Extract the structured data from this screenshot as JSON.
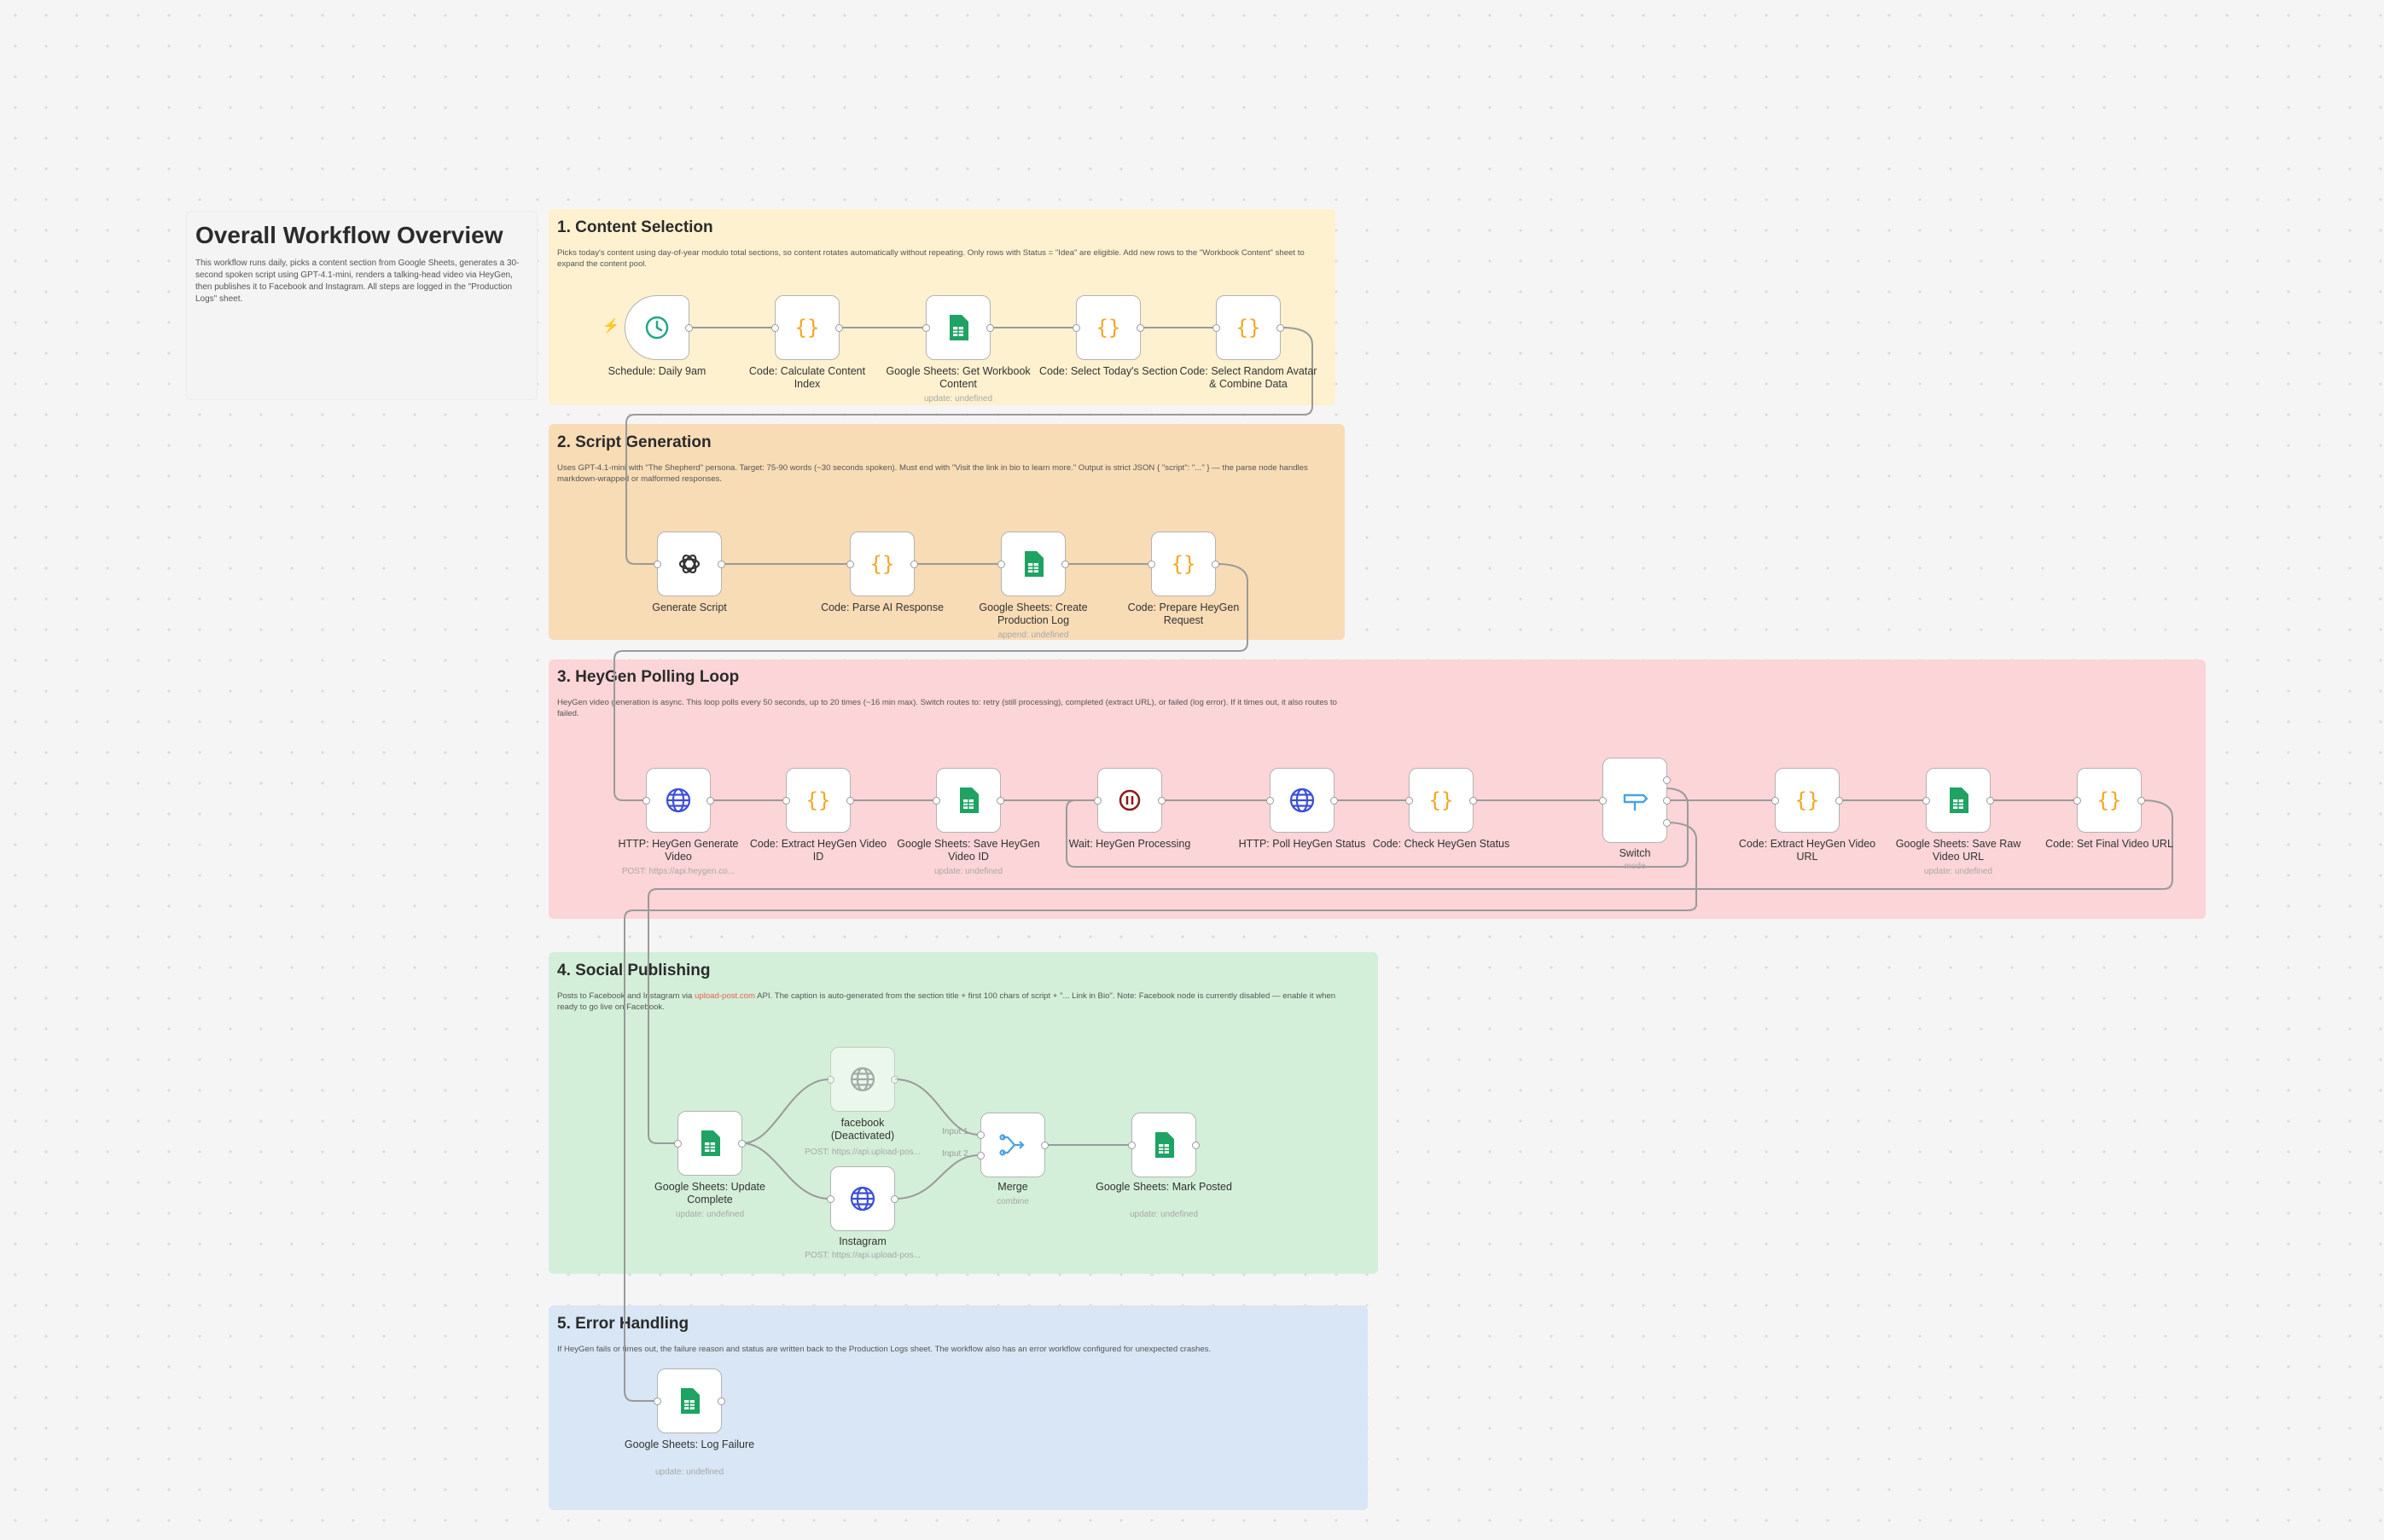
{
  "overview": {
    "title": "Overall Workflow Overview",
    "text": "This workflow runs daily, picks a content section from Google Sheets, generates a 30-second spoken script using GPT-4.1-mini, renders a talking-head video via HeyGen, then publishes it to Facebook and Instagram. All steps are logged in the \"Production Logs\" sheet."
  },
  "sections": {
    "s1": {
      "title": "1. Content Selection",
      "text": "Picks today's content using day-of-year modulo total sections, so content rotates automatically without repeating. Only rows with Status = \"Idea\" are eligible. Add new rows to the \"Workbook Content\" sheet to expand the content pool."
    },
    "s2": {
      "title": "2. Script Generation",
      "text": "Uses GPT-4.1-mini with \"The Shepherd\" persona. Target: 75-90 words (~30 seconds spoken). Must end with \"Visit the link in bio to learn more.\" Output is strict JSON { \"script\": \"...\" } — the parse node handles markdown-wrapped or malformed responses."
    },
    "s3": {
      "title": "3. HeyGen Polling Loop",
      "text": "HeyGen video generation is async. This loop polls every 50 seconds, up to 20 times (~16 min max). Switch routes to: retry (still processing), completed (extract URL), or failed (log error). If it times out, it also routes to failed."
    },
    "s4": {
      "title": "4. Social Publishing",
      "text_before": "Posts to Facebook and Instagram via ",
      "link": "upload-post.com",
      "text_after": " API. The caption is auto-generated from the section title + first 100 chars of script + \"... Link in Bio\". Note: Facebook node is currently disabled — enable it when ready to go live on Facebook."
    },
    "s5": {
      "title": "5. Error Handling",
      "text": "If HeyGen fails or times out, the failure reason and status are written back to the Production Logs sheet. The workflow also has an error workflow configured for unexpected crashes."
    }
  },
  "icons": {
    "schedule": "clock-icon",
    "code": "braces-icon",
    "sheets": "google-sheets-icon",
    "openai": "openai-icon",
    "http": "globe-icon",
    "wait": "pause-icon",
    "switch": "switch-icon",
    "merge": "merge-icon"
  },
  "colors": {
    "code": "#f5a623",
    "sheets": "#1ea362",
    "http": "#3b4fd6",
    "wait": "#8b1a1a",
    "switch": "#4aa3df",
    "clock": "#20a88a"
  },
  "nodes": {
    "schedule": {
      "label": "Schedule: Daily 9am"
    },
    "calcIndex": {
      "label": "Code: Calculate Content Index"
    },
    "getWorkbook": {
      "label": "Google Sheets: Get Workbook Content",
      "sub": "update: undefined"
    },
    "selectSection": {
      "label": "Code: Select Today's Section"
    },
    "selectAvatar": {
      "label": "Code: Select Random Avatar & Combine Data"
    },
    "genScript": {
      "label": "Generate Script"
    },
    "parseAI": {
      "label": "Code: Parse AI Response"
    },
    "createLog": {
      "label": "Google Sheets: Create Production Log",
      "sub": "append: undefined"
    },
    "prepHeygen": {
      "label": "Code: Prepare HeyGen Request"
    },
    "httpGen": {
      "label": "HTTP: HeyGen Generate Video",
      "sub": "POST: https://api.heygen.co..."
    },
    "extractId": {
      "label": "Code: Extract HeyGen Video ID"
    },
    "saveId": {
      "label": "Google Sheets: Save HeyGen Video ID",
      "sub": "update: undefined"
    },
    "wait": {
      "label": "Wait: HeyGen Processing"
    },
    "poll": {
      "label": "HTTP: Poll HeyGen Status"
    },
    "checkStatus": {
      "label": "Code: Check HeyGen Status"
    },
    "switch": {
      "label": "Switch",
      "sub": "mode"
    },
    "extractUrl": {
      "label": "Code: Extract HeyGen Video URL"
    },
    "saveRaw": {
      "label": "Google Sheets: Save Raw Video URL",
      "sub": "update: undefined"
    },
    "setFinal": {
      "label": "Code: Set Final Video URL"
    },
    "updateComplete": {
      "label": "Google Sheets: Update Complete",
      "sub": "update: undefined"
    },
    "facebook": {
      "label": "facebook (Deactivated)",
      "sub": "POST: https://api.upload-pos..."
    },
    "instagram": {
      "label": "Instagram",
      "sub": "POST: https://api.upload-pos..."
    },
    "merge": {
      "label": "Merge",
      "sub": "combine",
      "input1": "Input 1",
      "input2": "Input 2"
    },
    "markPosted": {
      "label": "Google Sheets: Mark Posted",
      "sub": "update: undefined"
    },
    "logFailure": {
      "label": "Google Sheets: Log Failure",
      "sub": "update: undefined"
    }
  }
}
